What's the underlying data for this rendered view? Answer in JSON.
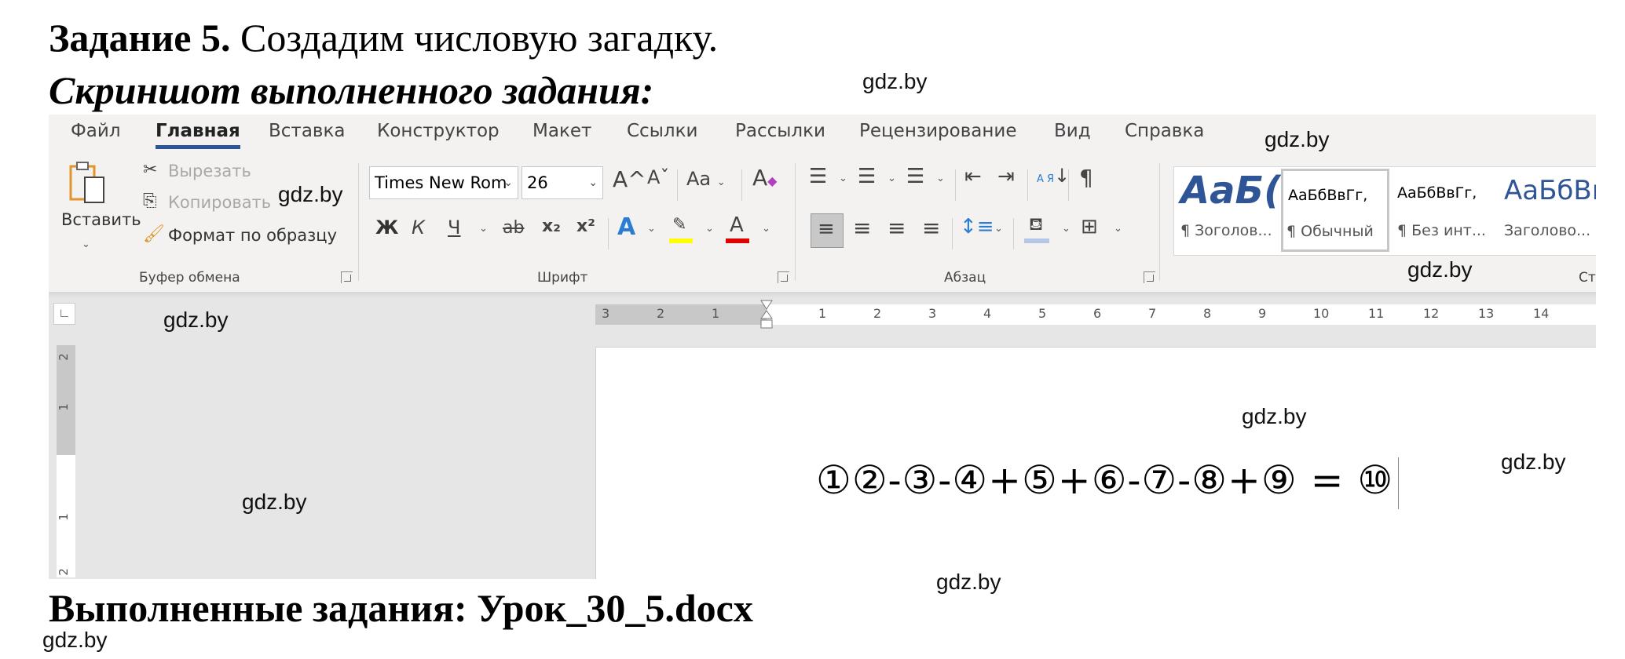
{
  "task_heading": {
    "bold": "Задание 5.",
    "rest": " Создадим числовую загадку."
  },
  "screenshot_heading": "Скриншот выполненного задания:",
  "footer_title": "Выполненные задания: Урок_30_5.docx",
  "watermark": "gdz.by",
  "word": {
    "tabs": [
      "Файл",
      "Главная",
      "Вставка",
      "Конструктор",
      "Макет",
      "Ссылки",
      "Рассылки",
      "Рецензирование",
      "Вид",
      "Справка"
    ],
    "active_tab": "Главная",
    "clipboard": {
      "paste_label": "Вставить",
      "cut_label": "Вырезать",
      "copy_label": "Копировать",
      "format_painter_label": "Формат по образцу",
      "group_label": "Буфер обмена"
    },
    "font": {
      "font_name": "Times New Rom",
      "font_size": "26",
      "grow_label": "A^",
      "shrink_label": "Aˇ",
      "change_case_label": "Aa",
      "bold_label": "Ж",
      "italic_label": "К",
      "underline_label": "Ч",
      "strike_label": "ab",
      "subscript_label": "x₂",
      "superscript_label": "x²",
      "group_label": "Шрифт",
      "highlight_color": "#ffff00",
      "font_color": "#e00000"
    },
    "paragraph": {
      "group_label": "Абзац",
      "sort_label": "А Я",
      "pilcrow": "¶"
    },
    "styles": {
      "items": [
        {
          "preview": "АаБ(",
          "name": "¶ Зоголов..."
        },
        {
          "preview": "АаБбВвГг,",
          "name": "¶ Обычный"
        },
        {
          "preview": "АаБбВвГг,",
          "name": "¶ Без инт..."
        },
        {
          "preview": "АаБбВı",
          "name": "Заголово..."
        }
      ],
      "selected": "¶ Обычный",
      "group_label": "Сти"
    },
    "ruler": {
      "left_ticks": [
        "3",
        "2",
        "1"
      ],
      "right_ticks": [
        "1",
        "2",
        "3",
        "4",
        "5",
        "6",
        "7",
        "8",
        "9",
        "10",
        "11",
        "12",
        "13",
        "14"
      ],
      "vertical_ticks": [
        "2",
        "1",
        "1",
        "2"
      ]
    },
    "document": {
      "puzzle": "①②-③-④+⑤+⑥-⑦-⑧+⑨ = ⑩"
    }
  }
}
